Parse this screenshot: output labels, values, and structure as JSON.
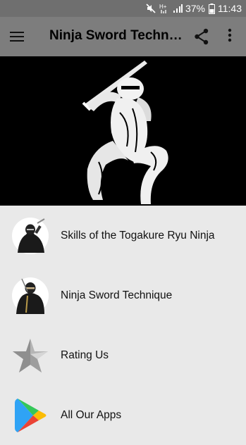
{
  "status_bar": {
    "battery": "37%",
    "time": "11:43",
    "icons": [
      "mute-icon",
      "hplus-signal-icon",
      "cell-signal-icon",
      "battery-icon"
    ]
  },
  "app_bar": {
    "title": "Ninja Sword Techni…",
    "icons": [
      "menu-icon",
      "share-icon",
      "more-vert-icon"
    ]
  },
  "hero": {
    "image": "ninja-silhouette-with-sword"
  },
  "menu": {
    "items": [
      {
        "label": "Skills of the Togakure Ryu Ninja",
        "icon": "ninja-photo-thumbnail"
      },
      {
        "label": "Ninja Sword Technique",
        "icon": "ninja-sword-thumbnail"
      },
      {
        "label": "Rating Us",
        "icon": "silver-star-icon"
      },
      {
        "label": "All Our Apps",
        "icon": "play-store-icon"
      }
    ]
  },
  "colors": {
    "status_bar": "#6f6f6f",
    "app_bar": "#7d7d7d",
    "background": "#e9e9e9",
    "hero": "#000000"
  }
}
